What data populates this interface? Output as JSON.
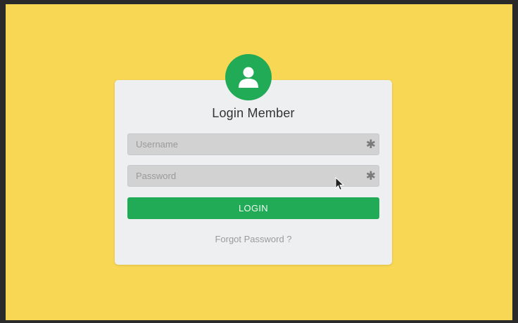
{
  "login": {
    "title": "Login Member",
    "username_placeholder": "Username",
    "password_placeholder": "Password",
    "required_marker": "✱",
    "login_label": "LOGIN",
    "forgot_label": "Forgot Password ?"
  },
  "icons": {
    "avatar": "user-icon",
    "cursor": "mouse-pointer-icon"
  },
  "colors": {
    "background": "#f8d755",
    "accent": "#22ab57",
    "card": "#eeeff0",
    "field": "#d2d2d3"
  }
}
